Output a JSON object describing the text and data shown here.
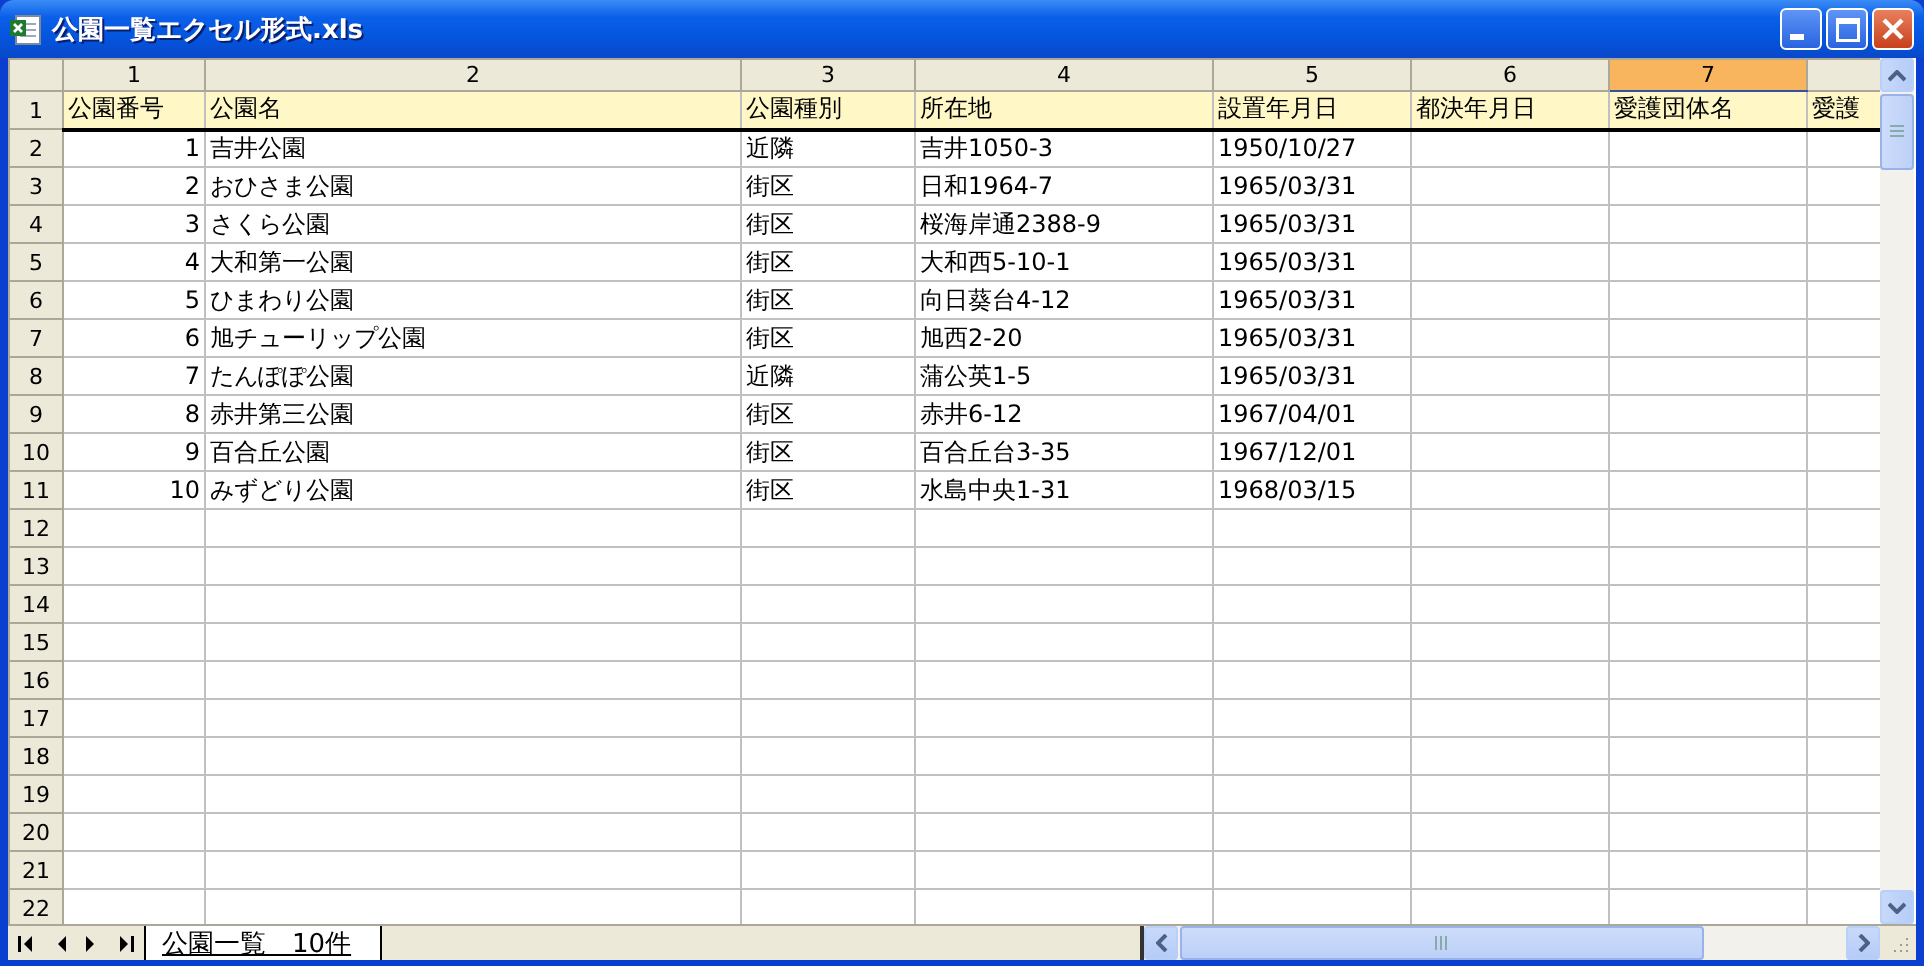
{
  "window": {
    "title": "公園一覧エクセル形式.xls"
  },
  "columns": [
    {
      "label": "1",
      "selected": false
    },
    {
      "label": "2",
      "selected": false
    },
    {
      "label": "3",
      "selected": false
    },
    {
      "label": "4",
      "selected": false
    },
    {
      "label": "5",
      "selected": false
    },
    {
      "label": "6",
      "selected": false
    },
    {
      "label": "7",
      "selected": true
    }
  ],
  "rows": [
    {
      "number": "1",
      "kind": "header",
      "cells": [
        "公園番号",
        "公園名",
        "公園種別",
        "所在地",
        "設置年月日",
        "都決年月日",
        "愛護団体名",
        "愛護"
      ]
    },
    {
      "number": "2",
      "kind": "data",
      "cells": [
        "1",
        "吉井公園",
        "近隣",
        "吉井1050-3",
        "1950/10/27"
      ]
    },
    {
      "number": "3",
      "kind": "data",
      "cells": [
        "2",
        "おひさま公園",
        "街区",
        "日和1964-7",
        "1965/03/31"
      ]
    },
    {
      "number": "4",
      "kind": "data",
      "cells": [
        "3",
        "さくら公園",
        "街区",
        "桜海岸通2388-9",
        "1965/03/31"
      ]
    },
    {
      "number": "5",
      "kind": "data",
      "cells": [
        "4",
        "大和第一公園",
        "街区",
        "大和西5-10-1",
        "1965/03/31"
      ]
    },
    {
      "number": "6",
      "kind": "data",
      "cells": [
        "5",
        "ひまわり公園",
        "街区",
        "向日葵台4-12",
        "1965/03/31"
      ]
    },
    {
      "number": "7",
      "kind": "data",
      "cells": [
        "6",
        "旭チューリップ公園",
        "街区",
        "旭西2-20",
        "1965/03/31"
      ]
    },
    {
      "number": "8",
      "kind": "data",
      "cells": [
        "7",
        "たんぽぽ公園",
        "近隣",
        "蒲公英1-5",
        "1965/03/31"
      ]
    },
    {
      "number": "9",
      "kind": "data",
      "cells": [
        "8",
        "赤井第三公園",
        "街区",
        "赤井6-12",
        "1967/04/01"
      ]
    },
    {
      "number": "10",
      "kind": "data",
      "cells": [
        "9",
        "百合丘公園",
        "街区",
        "百合丘台3-35",
        "1967/12/01"
      ]
    },
    {
      "number": "11",
      "kind": "data",
      "cells": [
        "10",
        "みずどり公園",
        "街区",
        "水島中央1-31",
        "1968/03/15"
      ]
    },
    {
      "number": "12",
      "kind": "data",
      "cells": []
    },
    {
      "number": "13",
      "kind": "data",
      "cells": []
    },
    {
      "number": "14",
      "kind": "data",
      "cells": []
    },
    {
      "number": "15",
      "kind": "data",
      "cells": []
    },
    {
      "number": "16",
      "kind": "data",
      "cells": []
    },
    {
      "number": "17",
      "kind": "data",
      "cells": []
    },
    {
      "number": "18",
      "kind": "data",
      "cells": []
    },
    {
      "number": "19",
      "kind": "data",
      "cells": []
    },
    {
      "number": "20",
      "kind": "data",
      "cells": []
    },
    {
      "number": "21",
      "kind": "data",
      "cells": []
    },
    {
      "number": "22",
      "kind": "data",
      "cells": []
    }
  ],
  "sheet_tabs": [
    {
      "label": "公園一覧　10件",
      "selected": true
    }
  ]
}
